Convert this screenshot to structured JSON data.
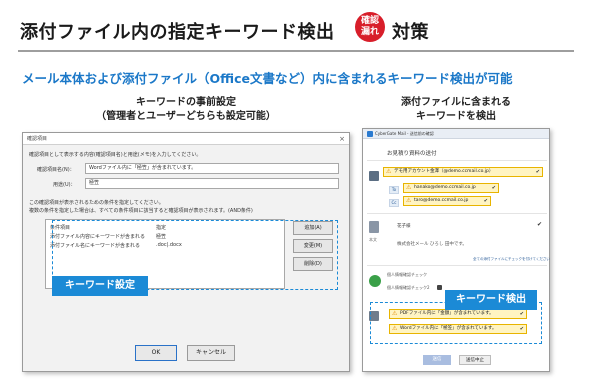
{
  "header": {
    "title_left": "添付ファイル内の指定キーワード検出",
    "badge_line1": "確認",
    "badge_line2": "漏れ",
    "title_right": "対策",
    "subtitle": "メール本体および添付ファイル（Office文書など）内に含まれるキーワード検出が可能"
  },
  "left_caption": {
    "line1": "キーワードの事前設定",
    "line2": "（管理者とユーザーどちらも設定可能）"
  },
  "right_caption": {
    "line1": "添付ファイルに含まれる",
    "line2": "キーワードを検出"
  },
  "settings_dialog": {
    "title": "確認項目",
    "close_glyph": "×",
    "instruction": "確認項目として表示する内容(確認項目名)と用途(メモ)を入力してください。",
    "name_label": "確認項目名(N)：",
    "name_value": "Wordファイル内に「極笠」が含まれています。",
    "memo_label": "用途(U)：",
    "memo_value": "極笠",
    "cond_note1": "この確認項目が表示されるための条件を指定してください。",
    "cond_note2": "複数の条件を指定した場合は、すべての条件項目に該当すると確認項目が表示されます。(AND条件)",
    "list_headers": [
      "条件項目",
      "指定"
    ],
    "list_rows": [
      [
        "添付ファイル内容にキーワードが含まれる",
        "極笠"
      ],
      [
        "添付ファイル名にキーワードが含まれる",
        ".doc|.docx"
      ]
    ],
    "add_button": "追加(A)",
    "edit_button": "変更(M)",
    "delete_button": "削除(D)",
    "ok_button": "OK",
    "cancel_button": "キャンセル"
  },
  "keyword_setting_tag": "キーワード設定",
  "mail_window": {
    "title": "CyberGate Mail - 送信前の確認",
    "subject": "お見積り資料の送付",
    "sender": "デモ用アカウント金澤（@demo.ccmail.co.jp）",
    "to_label": "To",
    "to_address": "hanako@demo.ccmail.co.jp",
    "cc_label": "Cc",
    "cc_address": "taro@demo.ccmail.co.jp",
    "body_label": "本文",
    "body_line1": "花子様",
    "body_line2": "株式会社メール ひろし 田中です。",
    "attach_note": "全ての添付ファイルにチェックを付けてください",
    "attach_line1": "個人情報確認チェック",
    "attach_line2": "個人情報確認チェック2",
    "detect_row1": "PDFファイル内に「金額」が含まれています。",
    "detect_row2": "Wordファイル内に「極笠」が含まれています。",
    "send_button": "送信",
    "stop_button": "送信中止",
    "warn_glyph": "⚠",
    "check_glyph": "✔"
  },
  "keyword_detect_tag": "キーワード検出",
  "colors": {
    "accent_blue": "#1b8ad6",
    "subtitle_blue": "#1b78c8",
    "badge_red": "#d81e2a",
    "warning_yellow": "#fff4c2"
  }
}
